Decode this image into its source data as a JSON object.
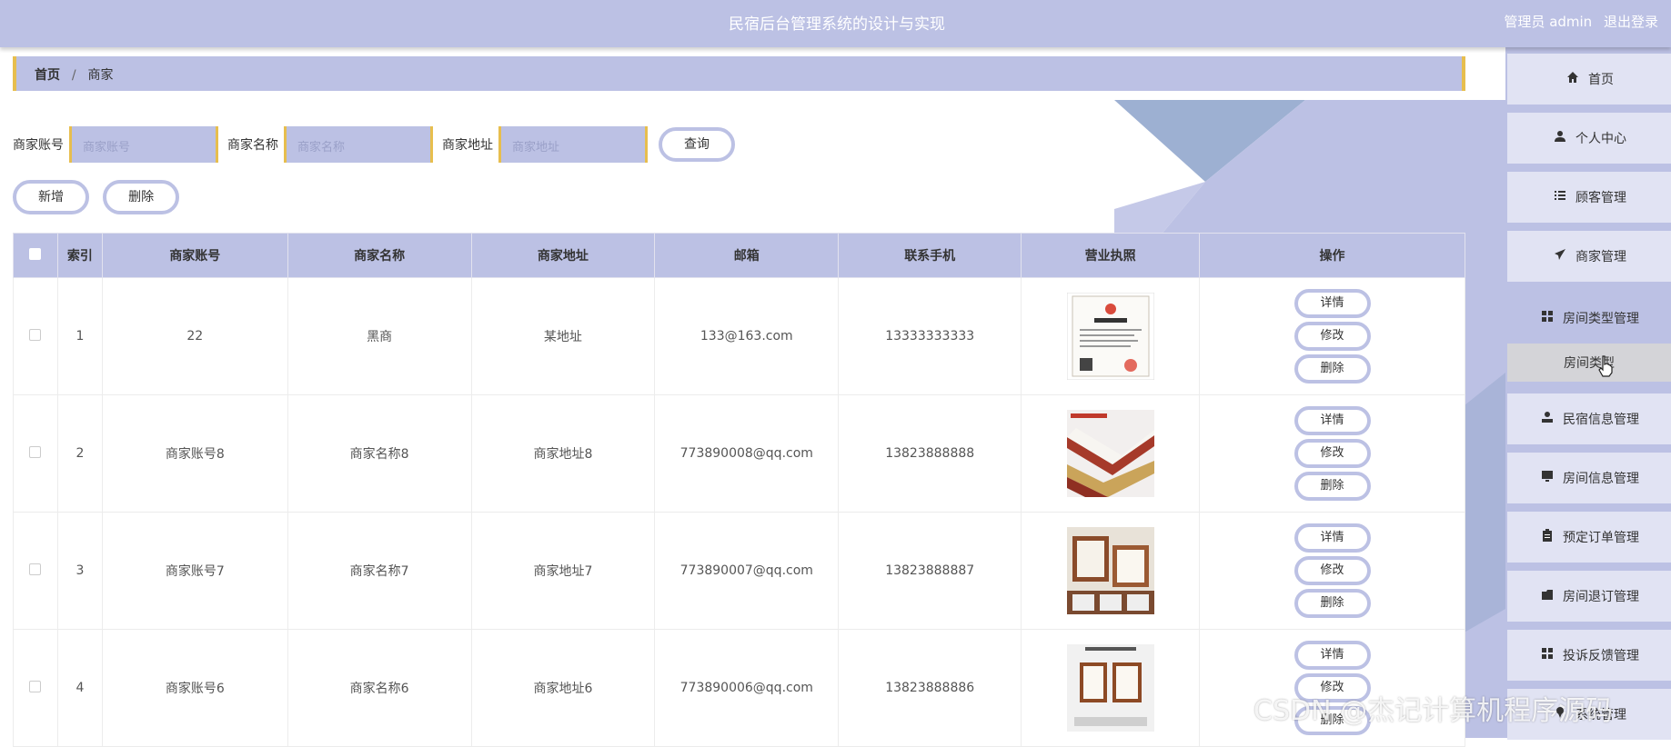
{
  "header": {
    "title": "民宿后台管理系统的设计与实现",
    "role": "管理员 admin",
    "logout": "退出登录"
  },
  "breadcrumb": {
    "home": "首页",
    "sep": "/",
    "current": "商家"
  },
  "search": {
    "fields": [
      {
        "label": "商家账号",
        "placeholder": "商家账号"
      },
      {
        "label": "商家名称",
        "placeholder": "商家名称"
      },
      {
        "label": "商家地址",
        "placeholder": "商家地址"
      }
    ],
    "query_button": "查询"
  },
  "actions": {
    "add": "新增",
    "delete": "删除"
  },
  "table": {
    "columns": [
      "索引",
      "商家账号",
      "商家名称",
      "商家地址",
      "邮箱",
      "联系手机",
      "营业执照",
      "操作"
    ],
    "rows": [
      {
        "index": "1",
        "account": "22",
        "name": "黑商",
        "address": "某地址",
        "email": "133@163.com",
        "phone": "13333333333",
        "license": "certificate-image"
      },
      {
        "index": "2",
        "account": "商家账号8",
        "name": "商家名称8",
        "address": "商家地址8",
        "email": "773890008@qq.com",
        "phone": "13823888888",
        "license": "certificate-frames-image"
      },
      {
        "index": "3",
        "account": "商家账号7",
        "name": "商家名称7",
        "address": "商家地址7",
        "email": "773890007@qq.com",
        "phone": "13823888887",
        "license": "framed-certificates-image"
      },
      {
        "index": "4",
        "account": "商家账号6",
        "name": "商家名称6",
        "address": "商家地址6",
        "email": "773890006@qq.com",
        "phone": "13823888886",
        "license": "wall-certificate-image"
      }
    ],
    "row_actions": {
      "detail": "详情",
      "edit": "修改",
      "delete": "删除"
    }
  },
  "sidebar": {
    "items": [
      {
        "label": "首页",
        "icon": "home-icon"
      },
      {
        "label": "个人中心",
        "icon": "user-icon"
      },
      {
        "label": "顾客管理",
        "icon": "list-icon"
      },
      {
        "label": "商家管理",
        "icon": "paper-plane-icon"
      },
      {
        "label": "房间类型管理",
        "icon": "grid-icon"
      },
      {
        "label": "民宿信息管理",
        "icon": "person-icon"
      },
      {
        "label": "房间信息管理",
        "icon": "monitor-icon"
      },
      {
        "label": "预定订单管理",
        "icon": "clipboard-icon"
      },
      {
        "label": "房间退订管理",
        "icon": "folder-icon"
      },
      {
        "label": "投诉反馈管理",
        "icon": "grid-icon"
      },
      {
        "label": "系统管理",
        "icon": "pin-icon"
      }
    ],
    "sub_item": "房间类型"
  },
  "watermark": "CSDN @杰记计算机程序源码",
  "colors": {
    "theme": "#bcc1e4",
    "accent": "#e7be4e",
    "nav_item": "#e1e3f3",
    "sub_item": "#d4d4d8"
  }
}
